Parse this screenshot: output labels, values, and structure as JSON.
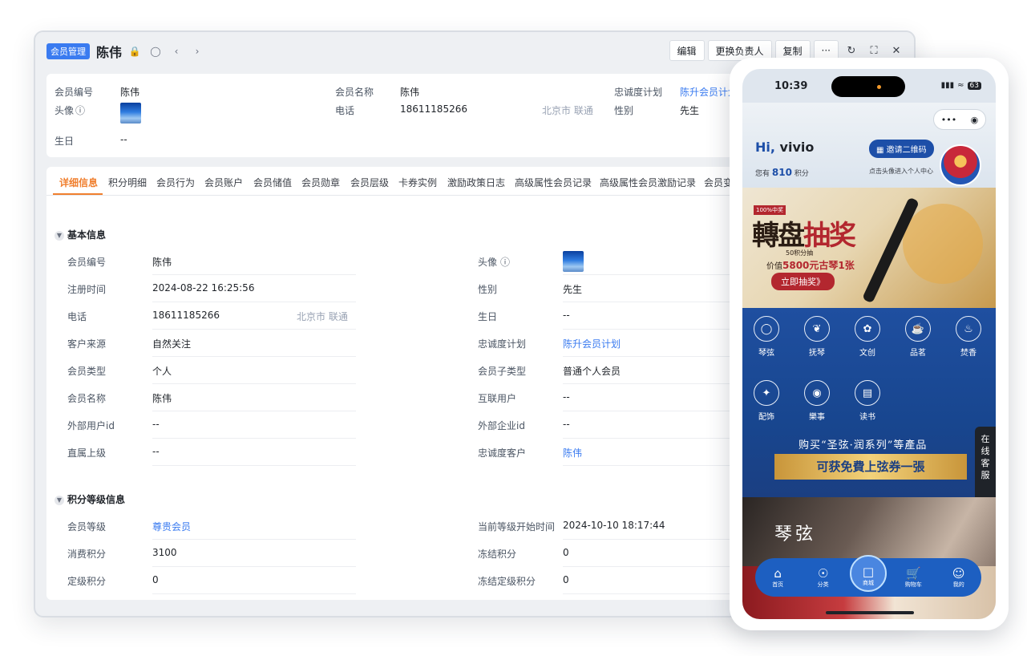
{
  "crm": {
    "tag": "会员管理",
    "title": "陈伟",
    "actions": [
      "编辑",
      "更换负责人",
      "复制",
      "···"
    ],
    "summary": {
      "member_no_label": "会员编号",
      "member_no": "陈伟",
      "avatar_label": "头像",
      "birthday_label": "生日",
      "birthday": "--",
      "member_name_label": "会员名称",
      "member_name": "陈伟",
      "phone_label": "电话",
      "phone": "18611185266",
      "phone_loc": "北京市 联通",
      "loyalty_label": "忠诚度计划",
      "loyalty": "陈升会员计划",
      "gender_label": "性别",
      "gender": "先生"
    },
    "tabs": [
      "详细信息",
      "积分明细",
      "会员行为",
      "会员账户",
      "会员储值",
      "会员勋章",
      "会员层级",
      "卡券实例",
      "激励政策日志",
      "高级属性会员记录",
      "高级属性会员激励记录",
      "会员变"
    ],
    "section_basic": "基本信息",
    "section_points": "积分等级信息",
    "basic_left": [
      {
        "k": "会员编号",
        "v": "陈伟"
      },
      {
        "k": "注册时间",
        "v": "2024-08-22 16:25:56"
      },
      {
        "k": "电话",
        "v": "18611185266",
        "extra": "北京市 联通"
      },
      {
        "k": "客户来源",
        "v": "自然关注"
      },
      {
        "k": "会员类型",
        "v": "个人"
      },
      {
        "k": "会员名称",
        "v": "陈伟"
      },
      {
        "k": "外部用户id",
        "v": "--"
      },
      {
        "k": "直属上级",
        "v": "--"
      }
    ],
    "basic_right": [
      {
        "k": "头像",
        "v": ""
      },
      {
        "k": "性别",
        "v": "先生"
      },
      {
        "k": "生日",
        "v": "--"
      },
      {
        "k": "忠诚度计划",
        "v": "陈升会员计划"
      },
      {
        "k": "会员子类型",
        "v": "普通个人会员"
      },
      {
        "k": "互联用户",
        "v": "--"
      },
      {
        "k": "外部企业id",
        "v": "--"
      },
      {
        "k": "忠诚度客户",
        "v": "陈伟"
      }
    ],
    "points_left": [
      {
        "k": "会员等级",
        "v": "尊贵会员"
      },
      {
        "k": "消费积分",
        "v": "3100"
      },
      {
        "k": "定级积分",
        "v": "0"
      }
    ],
    "points_right": [
      {
        "k": "当前等级开始时间",
        "v": "2024-10-10 18:17:44"
      },
      {
        "k": "冻结积分",
        "v": "0"
      },
      {
        "k": "冻结定级积分",
        "v": "0"
      }
    ]
  },
  "phone": {
    "time": "10:39",
    "battery": "63",
    "greeting_hi": "Hi,",
    "greeting_name": "vivio",
    "points_prefix": "您有",
    "points_value": "810",
    "points_suffix": "积分",
    "qr_button": "邀请二维码",
    "avatar_hint": "点击头像进入个人中心",
    "banner": {
      "badge": "100%中奖",
      "title_a": "轉盘",
      "title_b": "抽奖",
      "sub": "50积分抽",
      "sub2_prefix": "价值",
      "sub2_value": "5800元古琴1张",
      "button": "立即抽奖》"
    },
    "categories": [
      "琴弦",
      "抚琴",
      "文创",
      "品茗",
      "焚香",
      "配饰",
      "樂事",
      "读书"
    ],
    "promo1": "购买“圣弦·润系列”等產品",
    "promo2": "可获免費上弦券一張",
    "kefu": "在线客服",
    "qin_title": "琴弦",
    "nav": [
      "首页",
      "分类",
      "商城",
      "购物车",
      "我的"
    ]
  }
}
